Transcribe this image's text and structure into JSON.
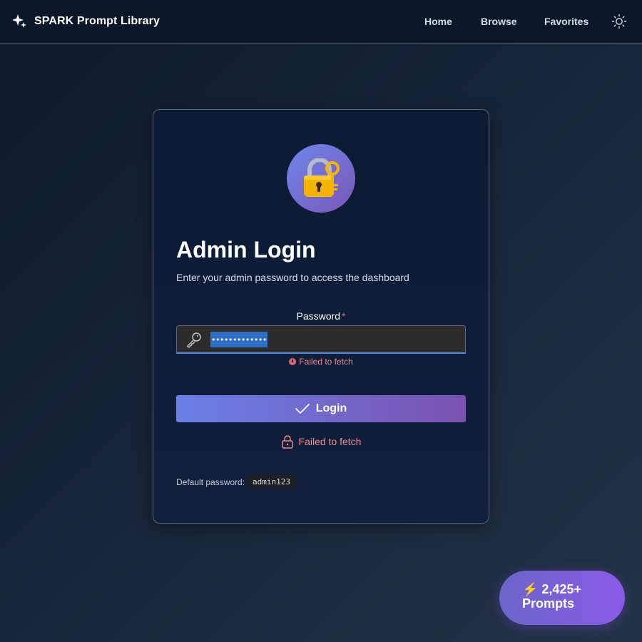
{
  "navbar": {
    "brand_title": "SPARK Prompt Library",
    "links": [
      {
        "label": "Home"
      },
      {
        "label": "Browse"
      },
      {
        "label": "Favorites"
      }
    ],
    "theme_icon": "sun-icon"
  },
  "login_card": {
    "icon": "locked-with-key-emoji",
    "title": "Admin Login",
    "subtitle": "Enter your admin password to access the dashboard",
    "password_label": "Password",
    "required_mark": "*",
    "password_value": "•••••••••••••",
    "field_error": "Failed to fetch",
    "login_button_label": "Login",
    "form_error": "Failed to fetch",
    "default_password_label": "Default password:",
    "default_password_value": "admin123"
  },
  "badge": {
    "line1": "⚡ 2,425+",
    "line2": "Prompts"
  },
  "colors": {
    "accent_gradient_start": "#6a80e8",
    "accent_gradient_end": "#7a52b0",
    "error": "#f08b8b",
    "focus_border": "#4f8fe8"
  }
}
